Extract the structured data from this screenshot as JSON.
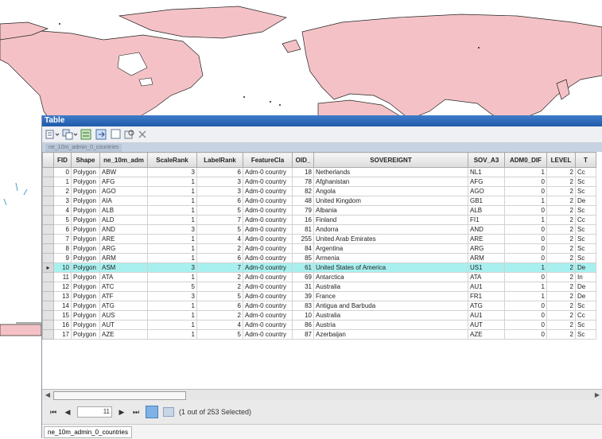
{
  "window": {
    "title": "Table"
  },
  "tabstrip": {
    "table_tab": "ne_10m_admin_0_countries"
  },
  "columns": [
    "",
    "FID",
    "Shape",
    "ne_10m_adm",
    "ScaleRank",
    "LabelRank",
    "FeatureCla",
    "OID_",
    "SOVEREIGNT",
    "SOV_A3",
    "ADM0_DIF",
    "LEVEL",
    "T"
  ],
  "rows": [
    {
      "fid": "0",
      "shape": "Polygon",
      "adm": "ABW",
      "scale": "3",
      "label": "6",
      "fcla": "Adm-0 country",
      "oid": "18",
      "sov": "Netherlands",
      "sova3": "NL1",
      "dif": "1",
      "level": "2",
      "t": "Cc"
    },
    {
      "fid": "1",
      "shape": "Polygon",
      "adm": "AFG",
      "scale": "1",
      "label": "3",
      "fcla": "Adm-0 country",
      "oid": "78",
      "sov": "Afghanistan",
      "sova3": "AFG",
      "dif": "0",
      "level": "2",
      "t": "Sc"
    },
    {
      "fid": "2",
      "shape": "Polygon",
      "adm": "AGO",
      "scale": "1",
      "label": "3",
      "fcla": "Adm-0 country",
      "oid": "82",
      "sov": "Angola",
      "sova3": "AGO",
      "dif": "0",
      "level": "2",
      "t": "Sc"
    },
    {
      "fid": "3",
      "shape": "Polygon",
      "adm": "AIA",
      "scale": "1",
      "label": "6",
      "fcla": "Adm-0 country",
      "oid": "48",
      "sov": "United Kingdom",
      "sova3": "GB1",
      "dif": "1",
      "level": "2",
      "t": "De"
    },
    {
      "fid": "4",
      "shape": "Polygon",
      "adm": "ALB",
      "scale": "1",
      "label": "5",
      "fcla": "Adm-0 country",
      "oid": "79",
      "sov": "Albania",
      "sova3": "ALB",
      "dif": "0",
      "level": "2",
      "t": "Sc"
    },
    {
      "fid": "5",
      "shape": "Polygon",
      "adm": "ALD",
      "scale": "1",
      "label": "7",
      "fcla": "Adm-0 country",
      "oid": "16",
      "sov": "Finland",
      "sova3": "FI1",
      "dif": "1",
      "level": "2",
      "t": "Cc"
    },
    {
      "fid": "6",
      "shape": "Polygon",
      "adm": "AND",
      "scale": "3",
      "label": "5",
      "fcla": "Adm-0 country",
      "oid": "81",
      "sov": "Andorra",
      "sova3": "AND",
      "dif": "0",
      "level": "2",
      "t": "Sc"
    },
    {
      "fid": "7",
      "shape": "Polygon",
      "adm": "ARE",
      "scale": "1",
      "label": "4",
      "fcla": "Adm-0 country",
      "oid": "255",
      "sov": "United Arab Emirates",
      "sova3": "ARE",
      "dif": "0",
      "level": "2",
      "t": "Sc"
    },
    {
      "fid": "8",
      "shape": "Polygon",
      "adm": "ARG",
      "scale": "1",
      "label": "2",
      "fcla": "Adm-0 country",
      "oid": "84",
      "sov": "Argentina",
      "sova3": "ARG",
      "dif": "0",
      "level": "2",
      "t": "Sc"
    },
    {
      "fid": "9",
      "shape": "Polygon",
      "adm": "ARM",
      "scale": "1",
      "label": "6",
      "fcla": "Adm-0 country",
      "oid": "85",
      "sov": "Armenia",
      "sova3": "ARM",
      "dif": "0",
      "level": "2",
      "t": "Sc"
    },
    {
      "fid": "10",
      "shape": "Polygon",
      "adm": "ASM",
      "scale": "3",
      "label": "7",
      "fcla": "Adm-0 country",
      "oid": "61",
      "sov": "United States of America",
      "sova3": "US1",
      "dif": "1",
      "level": "2",
      "t": "De"
    },
    {
      "fid": "11",
      "shape": "Polygon",
      "adm": "ATA",
      "scale": "1",
      "label": "2",
      "fcla": "Adm-0 country",
      "oid": "69",
      "sov": "Antarctica",
      "sova3": "ATA",
      "dif": "0",
      "level": "2",
      "t": "In"
    },
    {
      "fid": "12",
      "shape": "Polygon",
      "adm": "ATC",
      "scale": "5",
      "label": "2",
      "fcla": "Adm-0 country",
      "oid": "31",
      "sov": "Australia",
      "sova3": "AU1",
      "dif": "1",
      "level": "2",
      "t": "De"
    },
    {
      "fid": "13",
      "shape": "Polygon",
      "adm": "ATF",
      "scale": "3",
      "label": "5",
      "fcla": "Adm-0 country",
      "oid": "39",
      "sov": "France",
      "sova3": "FR1",
      "dif": "1",
      "level": "2",
      "t": "De"
    },
    {
      "fid": "14",
      "shape": "Polygon",
      "adm": "ATG",
      "scale": "1",
      "label": "6",
      "fcla": "Adm-0 country",
      "oid": "83",
      "sov": "Antigua and Barbuda",
      "sova3": "ATG",
      "dif": "0",
      "level": "2",
      "t": "Sc"
    },
    {
      "fid": "15",
      "shape": "Polygon",
      "adm": "AUS",
      "scale": "1",
      "label": "2",
      "fcla": "Adm-0 country",
      "oid": "10",
      "sov": "Australia",
      "sova3": "AU1",
      "dif": "0",
      "level": "2",
      "t": "Cc"
    },
    {
      "fid": "16",
      "shape": "Polygon",
      "adm": "AUT",
      "scale": "1",
      "label": "4",
      "fcla": "Adm-0 country",
      "oid": "86",
      "sov": "Austria",
      "sova3": "AUT",
      "dif": "0",
      "level": "2",
      "t": "Sc"
    },
    {
      "fid": "17",
      "shape": "Polygon",
      "adm": "AZE",
      "scale": "1",
      "label": "5",
      "fcla": "Adm-0 country",
      "oid": "87",
      "sov": "Azerbaijan",
      "sova3": "AZE",
      "dif": "0",
      "level": "2",
      "t": "Sc"
    }
  ],
  "selected_row_index": 10,
  "navigation": {
    "current_record": "11",
    "selection_status": "(1 out of 253 Selected)"
  },
  "layer_tab": "ne_10m_admin_0_countries",
  "icons": {
    "table_options": "table-options-icon",
    "related_tables": "related-tables-icon",
    "select_by_attributes": "select-by-attributes-icon",
    "switch_selection": "switch-selection-icon",
    "clear_selection": "clear-selection-icon",
    "zoom_to_selected": "zoom-to-selected-icon",
    "delete_selected": "delete-icon"
  },
  "colors": {
    "land": "#f4c2c6",
    "selected_row": "#a8f0f0",
    "title_bar": "#2c67b5"
  }
}
